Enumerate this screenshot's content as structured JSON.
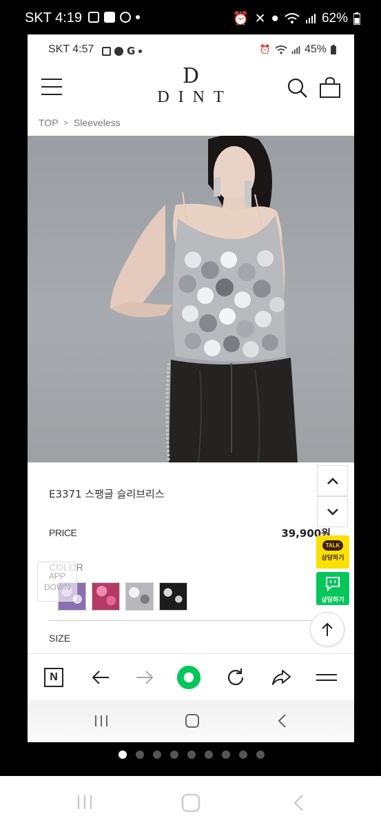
{
  "outer_status": {
    "time": "SKT 4:19",
    "battery": "62%"
  },
  "inner_status": {
    "time": "SKT 4:57",
    "battery": "45%"
  },
  "header": {
    "logo_mark": "D",
    "logo_word": "DINT",
    "menu_icon": "hamburger-icon",
    "search_icon": "search-icon",
    "bag_icon": "shopping-bag-icon"
  },
  "breadcrumb": {
    "home": "TOP",
    "separator": ">",
    "current": "Sleeveless"
  },
  "product": {
    "name": "E3371 스팽글 슬리브리스",
    "price_label": "PRICE",
    "price": "39,900원",
    "color_label": "COLOR",
    "size_label": "SIZE",
    "swatch_colors": [
      "#8a6fb0",
      "#b23a64",
      "#b8b8bc",
      "#1c1c1c"
    ]
  },
  "app_down": {
    "line1": "APP",
    "line2": "DOWN"
  },
  "floating": {
    "talk_bubble": "TALK",
    "talk_label": "상담하기",
    "naver_label": "상담하기"
  },
  "browser_bar": {
    "n_label": "N"
  },
  "pager": {
    "count": 9,
    "active": 0
  },
  "colors": {
    "kakao": "#fae100",
    "naver": "#03c75a"
  }
}
